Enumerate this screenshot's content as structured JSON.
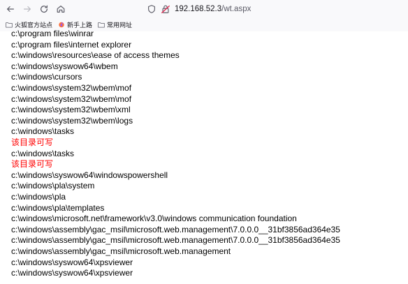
{
  "browser": {
    "url_host": "192.168.52.3",
    "url_path": "/wt.aspx",
    "bookmarks": [
      {
        "label": "火狐官方站点",
        "icon": "folder-icon"
      },
      {
        "label": "新手上路",
        "icon": "firefox-icon"
      },
      {
        "label": "常用网址",
        "icon": "folder-icon"
      }
    ]
  },
  "accent_colors": {
    "writable_text": "#ff0000",
    "normal_text": "#000000"
  },
  "lines": [
    {
      "text": "c:\\program files\\winrar",
      "writable": false
    },
    {
      "text": "c:\\program files\\internet explorer",
      "writable": false
    },
    {
      "text": "c:\\windows\\resources\\ease of access themes",
      "writable": false
    },
    {
      "text": "c:\\windows\\syswow64\\wbem",
      "writable": false
    },
    {
      "text": "c:\\windows\\cursors",
      "writable": false
    },
    {
      "text": "c:\\windows\\system32\\wbem\\mof",
      "writable": false
    },
    {
      "text": "c:\\windows\\system32\\wbem\\mof",
      "writable": false
    },
    {
      "text": "c:\\windows\\system32\\wbem\\xml",
      "writable": false
    },
    {
      "text": "c:\\windows\\system32\\wbem\\logs",
      "writable": false
    },
    {
      "text": "c:\\windows\\tasks",
      "writable": false
    },
    {
      "text": "该目录可写",
      "writable": true
    },
    {
      "text": "c:\\windows\\tasks",
      "writable": false
    },
    {
      "text": "该目录可写",
      "writable": true
    },
    {
      "text": "c:\\windows\\syswow64\\windowspowershell",
      "writable": false
    },
    {
      "text": "c:\\windows\\pla\\system",
      "writable": false
    },
    {
      "text": "c:\\windows\\pla",
      "writable": false
    },
    {
      "text": "c:\\windows\\pla\\templates",
      "writable": false
    },
    {
      "text": "c:\\windows\\microsoft.net\\framework\\v3.0\\windows communication foundation",
      "writable": false
    },
    {
      "text": "c:\\windows\\assembly\\gac_msil\\microsoft.web.management\\7.0.0.0__31bf3856ad364e35",
      "writable": false
    },
    {
      "text": "c:\\windows\\assembly\\gac_msil\\microsoft.web.management\\7.0.0.0__31bf3856ad364e35",
      "writable": false
    },
    {
      "text": "c:\\windows\\assembly\\gac_msil\\microsoft.web.management",
      "writable": false
    },
    {
      "text": "c:\\windows\\syswow64\\xpsviewer",
      "writable": false
    },
    {
      "text": "c:\\windows\\syswow64\\xpsviewer",
      "writable": false
    }
  ]
}
